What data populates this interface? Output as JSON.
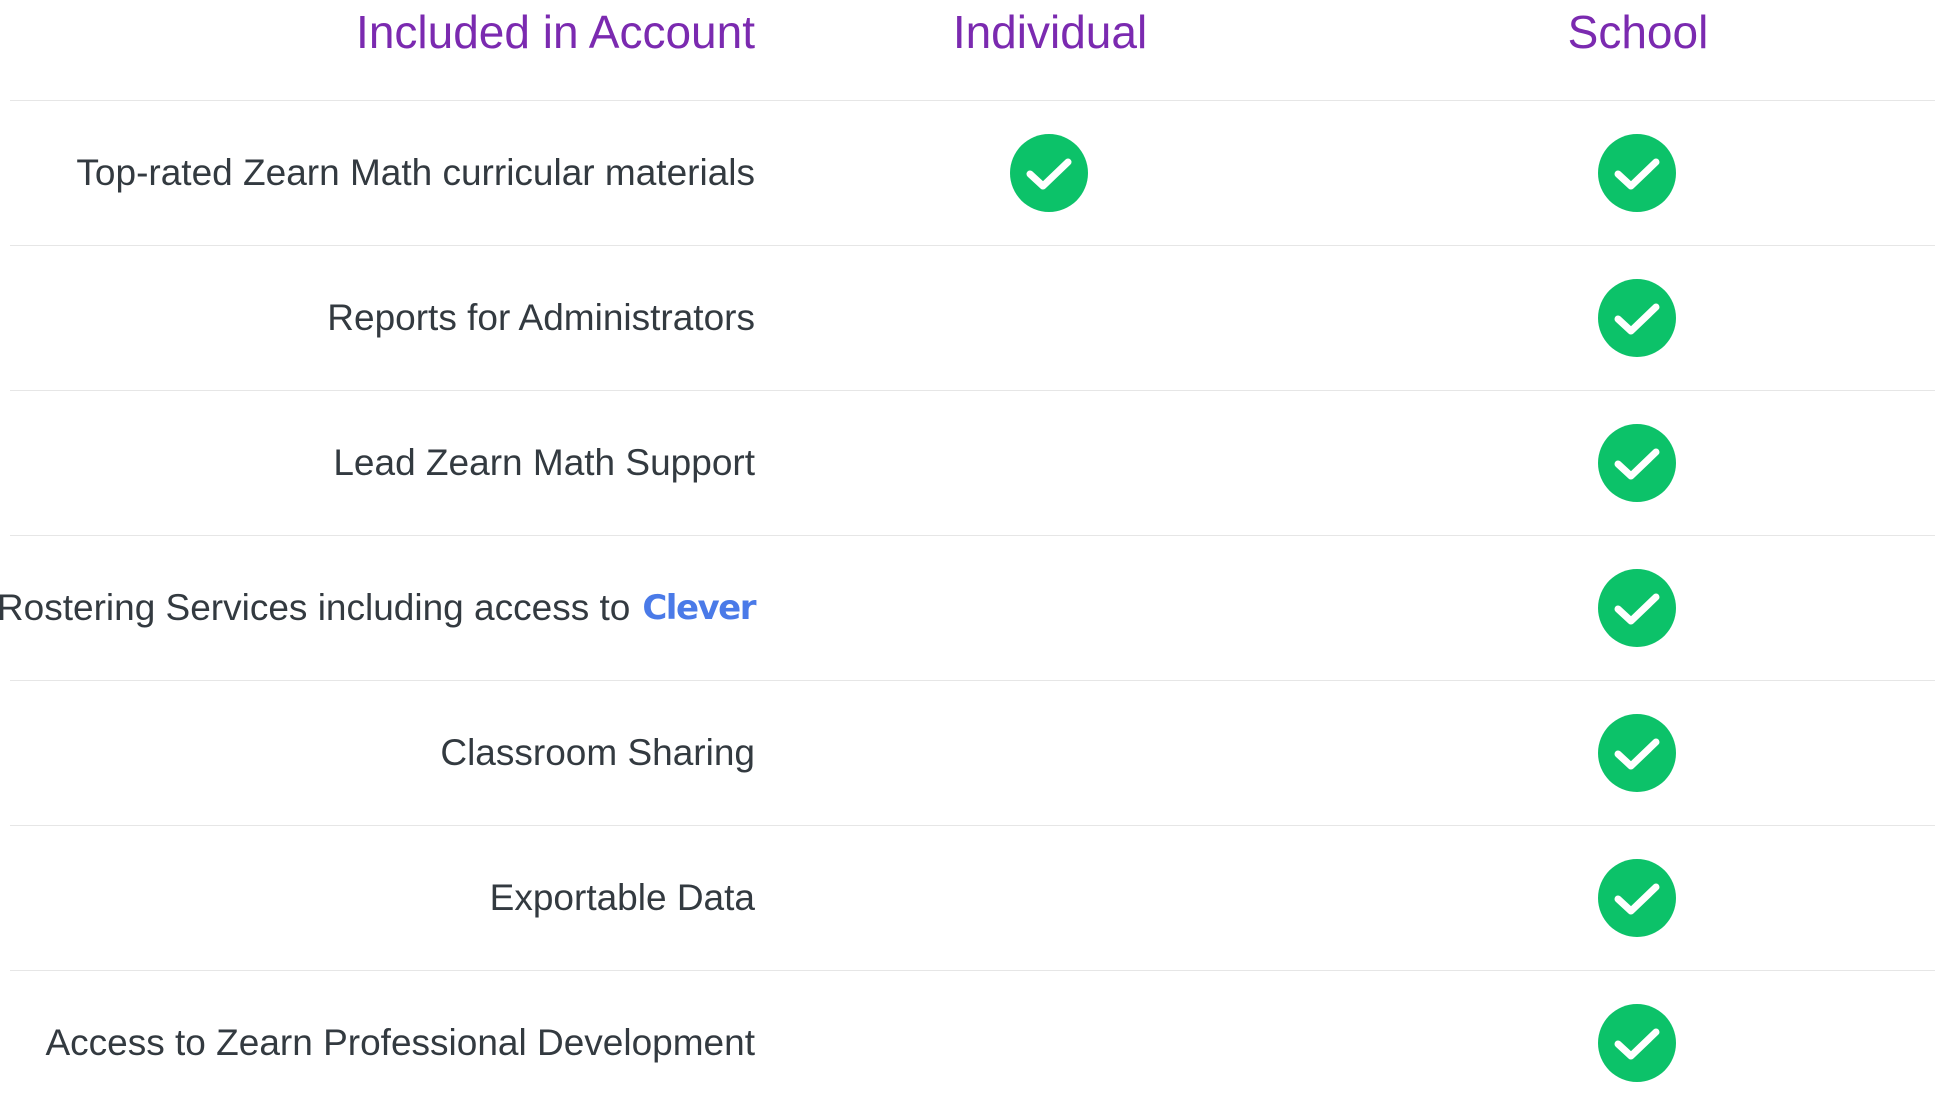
{
  "headers": {
    "feature": "Included in Account",
    "individual": "Individual",
    "school": "School"
  },
  "colors": {
    "header_text": "#7b2ab0",
    "check_green": "#0cc269",
    "body_text": "#333a40",
    "clever_blue": "#4a7ae8",
    "divider": "#e6e6e6"
  },
  "rows": [
    {
      "feature": "Top-rated Zearn Math curricular materials",
      "individual": true,
      "school": true,
      "icon": "check-circle-icon"
    },
    {
      "feature": "Reports for Administrators",
      "individual": false,
      "school": true,
      "icon": "check-circle-icon"
    },
    {
      "feature": "Lead Zearn Math Support",
      "individual": false,
      "school": true,
      "icon": "check-circle-icon"
    },
    {
      "feature": "Rostering Services including access to",
      "logo": "Clever",
      "individual": false,
      "school": true,
      "icon": "check-circle-icon"
    },
    {
      "feature": "Classroom Sharing",
      "individual": false,
      "school": true,
      "icon": "check-circle-icon"
    },
    {
      "feature": "Exportable Data",
      "individual": false,
      "school": true,
      "icon": "check-circle-icon"
    },
    {
      "feature": "Access to Zearn Professional Development",
      "individual": false,
      "school": true,
      "icon": "check-circle-icon"
    }
  ]
}
